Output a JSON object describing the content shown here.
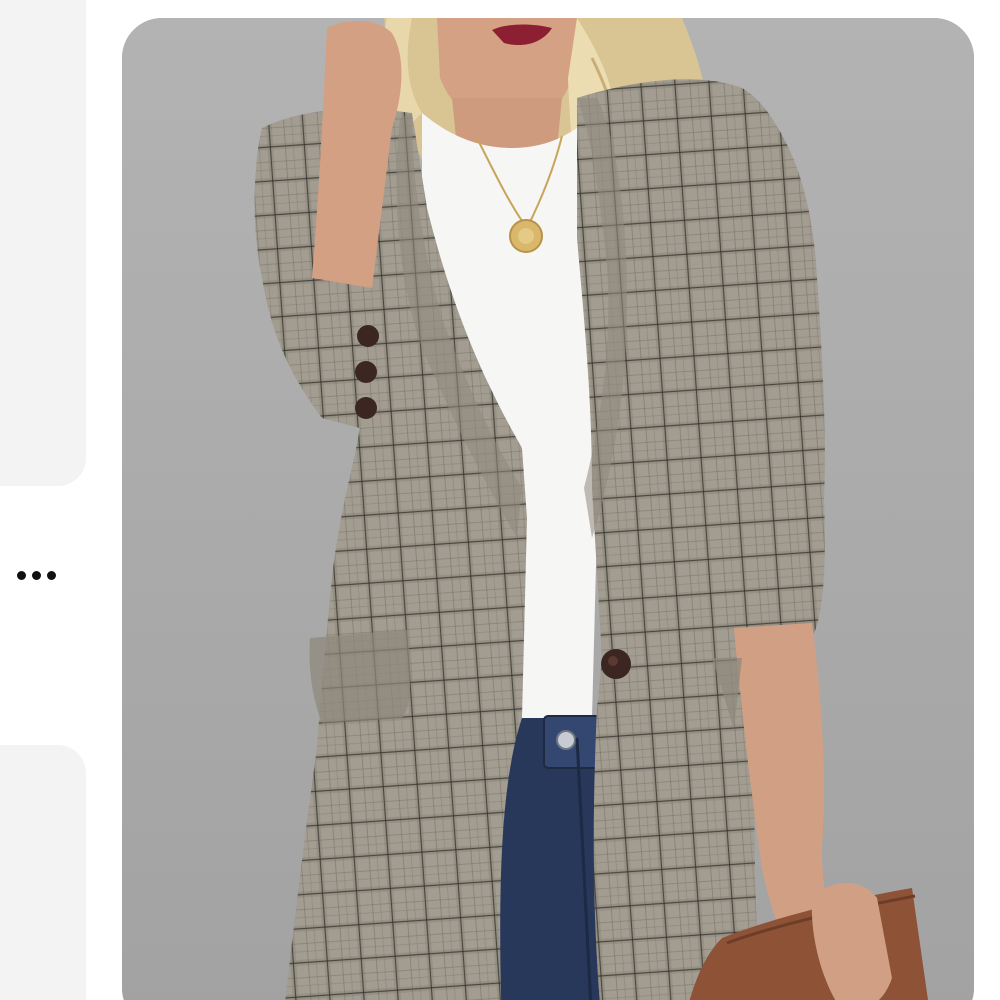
{
  "carousel": {
    "more_options_icon": "more-horizontal-icon",
    "main_item": {
      "image_subject": "photo",
      "colors": {
        "wall": "#a8a8a8",
        "blazer": "#9c968a",
        "plaid_dark": "#3a3633",
        "shirt": "#f6f6f4",
        "jeans": "#2a3a57",
        "hair": "#e7d5a8",
        "skin": "#d6a385",
        "lips": "#8d1f32",
        "clutch": "#8e5236",
        "button": "#3b2621"
      }
    }
  }
}
